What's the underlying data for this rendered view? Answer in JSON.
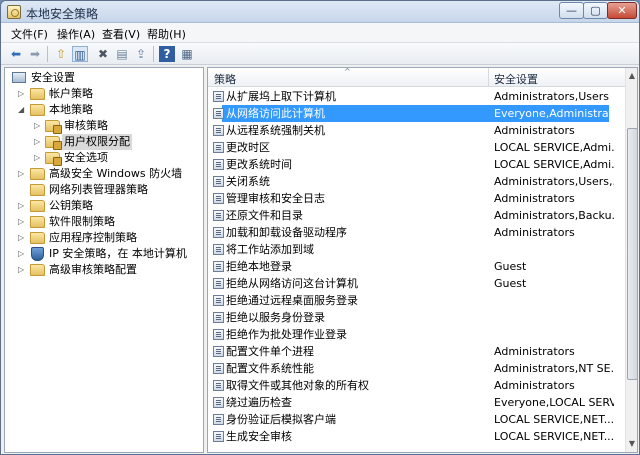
{
  "window": {
    "title": "本地安全策略",
    "min_glyph": "—",
    "max_glyph": "▢",
    "close_glyph": "✕"
  },
  "menu": [
    {
      "label": "文件(F)"
    },
    {
      "label": "操作(A)"
    },
    {
      "label": "查看(V)"
    },
    {
      "label": "帮助(H)"
    }
  ],
  "toolbar": {
    "icons": [
      "back-arrow-icon",
      "forward-arrow-icon",
      "up-folder-icon",
      "show-hide-tree-icon",
      "delete-icon",
      "properties-icon",
      "export-list-icon",
      "help-icon",
      "help-topics-icon"
    ],
    "glyphs": {
      "back": "⬅",
      "forward": "➡",
      "up": "⇧",
      "tree": "▥",
      "delete": "✖",
      "properties": "▤",
      "export": "⇪",
      "help": "?",
      "topics": "▦"
    }
  },
  "tree": [
    {
      "label": "安全设置",
      "level": 0,
      "expanded": true,
      "icon": "computer-icon"
    },
    {
      "label": "帐户策略",
      "level": 1,
      "expanded": false,
      "icon": "folder-icon"
    },
    {
      "label": "本地策略",
      "level": 1,
      "expanded": true,
      "icon": "folder-icon"
    },
    {
      "label": "审核策略",
      "level": 2,
      "expanded": false,
      "icon": "folder-lock-icon"
    },
    {
      "label": "用户权限分配",
      "level": 2,
      "expanded": false,
      "icon": "folder-lock-icon",
      "selected": true
    },
    {
      "label": "安全选项",
      "level": 2,
      "expanded": false,
      "icon": "folder-lock-icon"
    },
    {
      "label": "高级安全 Windows 防火墙",
      "level": 1,
      "expanded": false,
      "icon": "folder-icon"
    },
    {
      "label": "网络列表管理器策略",
      "level": 1,
      "expanded": null,
      "icon": "folder-icon"
    },
    {
      "label": "公钥策略",
      "level": 1,
      "expanded": false,
      "icon": "folder-icon"
    },
    {
      "label": "软件限制策略",
      "level": 1,
      "expanded": false,
      "icon": "folder-icon"
    },
    {
      "label": "应用程序控制策略",
      "level": 1,
      "expanded": false,
      "icon": "folder-icon"
    },
    {
      "label": "IP 安全策略，在 本地计算机",
      "level": 1,
      "expanded": false,
      "icon": "shield-icon"
    },
    {
      "label": "高级审核策略配置",
      "level": 1,
      "expanded": false,
      "icon": "folder-icon"
    }
  ],
  "columns": {
    "policy": "策略",
    "setting": "安全设置"
  },
  "rows": [
    {
      "name": "从扩展坞上取下计算机",
      "value": "Administrators,Users"
    },
    {
      "name": "从网络访问此计算机",
      "value": "Everyone,Administrat...",
      "selected": true
    },
    {
      "name": "从远程系统强制关机",
      "value": "Administrators"
    },
    {
      "name": "更改时区",
      "value": "LOCAL SERVICE,Admi..."
    },
    {
      "name": "更改系统时间",
      "value": "LOCAL SERVICE,Admi..."
    },
    {
      "name": "关闭系统",
      "value": "Administrators,Users,..."
    },
    {
      "name": "管理审核和安全日志",
      "value": "Administrators"
    },
    {
      "name": "还原文件和目录",
      "value": "Administrators,Backu..."
    },
    {
      "name": "加载和卸载设备驱动程序",
      "value": "Administrators"
    },
    {
      "name": "将工作站添加到域",
      "value": ""
    },
    {
      "name": "拒绝本地登录",
      "value": "Guest"
    },
    {
      "name": "拒绝从网络访问这台计算机",
      "value": "Guest"
    },
    {
      "name": "拒绝通过远程桌面服务登录",
      "value": ""
    },
    {
      "name": "拒绝以服务身份登录",
      "value": ""
    },
    {
      "name": "拒绝作为批处理作业登录",
      "value": ""
    },
    {
      "name": "配置文件单个进程",
      "value": "Administrators"
    },
    {
      "name": "配置文件系统性能",
      "value": "Administrators,NT SE..."
    },
    {
      "name": "取得文件或其他对象的所有权",
      "value": "Administrators"
    },
    {
      "name": "绕过遍历检查",
      "value": "Everyone,LOCAL SERV..."
    },
    {
      "name": "身份验证后模拟客户端",
      "value": "LOCAL SERVICE,NET..."
    },
    {
      "name": "生成安全审核",
      "value": "LOCAL SERVICE,NET..."
    }
  ],
  "scroll": {
    "up": "▲",
    "down": "▼",
    "sort": "^"
  }
}
